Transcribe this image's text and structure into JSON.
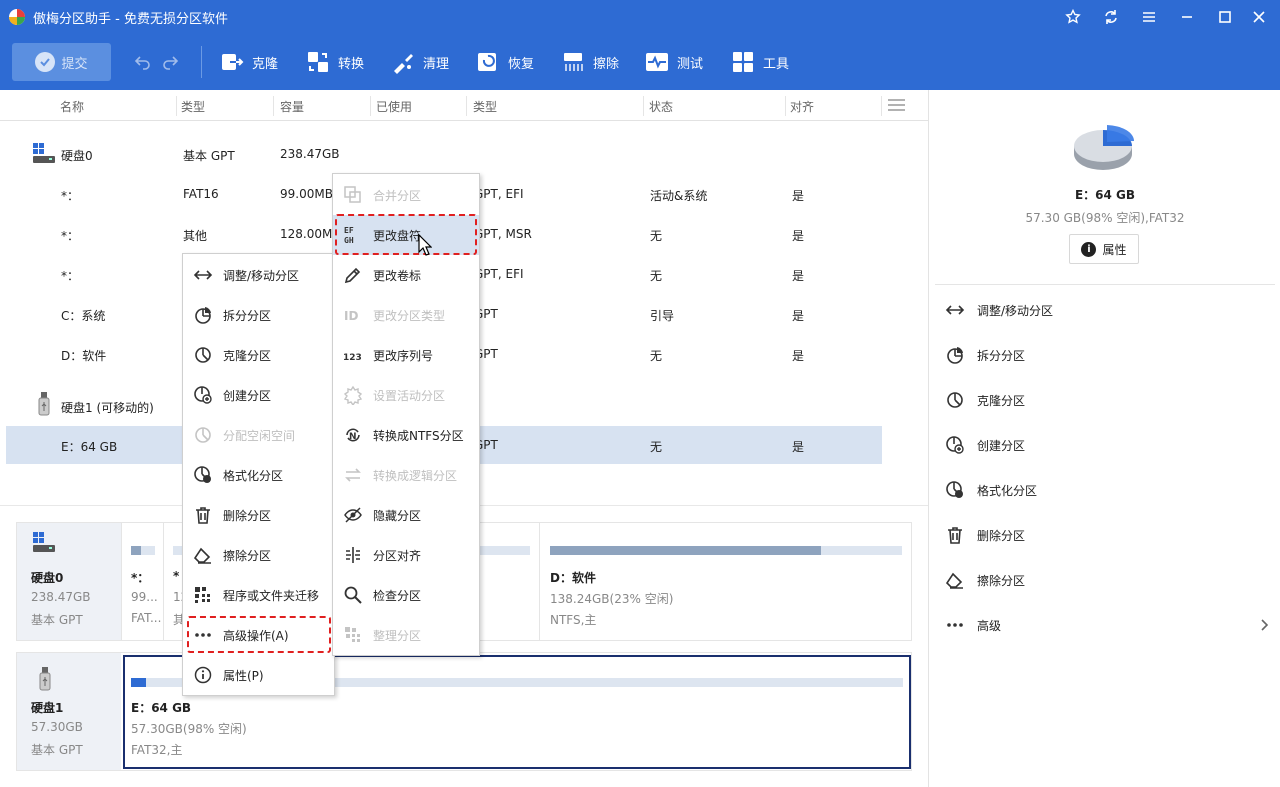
{
  "app": {
    "title": "傲梅分区助手 - 免费无损分区软件"
  },
  "toolbar": {
    "submit": "提交",
    "buttons": [
      {
        "label": "克隆",
        "icon": "clone-icon"
      },
      {
        "label": "转换",
        "icon": "convert-icon"
      },
      {
        "label": "清理",
        "icon": "clean-icon"
      },
      {
        "label": "恢复",
        "icon": "recover-icon"
      },
      {
        "label": "擦除",
        "icon": "wipe-icon"
      },
      {
        "label": "测试",
        "icon": "test-icon"
      },
      {
        "label": "工具",
        "icon": "tools-icon"
      }
    ]
  },
  "table": {
    "headers": [
      "名称",
      "类型",
      "容量",
      "已使用",
      "类型",
      "状态",
      "对齐"
    ],
    "rows": [
      {
        "name": "硬盘0",
        "type": "基本 GPT",
        "capacity": "238.47GB",
        "used": "",
        "ptype": "",
        "status": "",
        "align": ""
      },
      {
        "name": "*：",
        "type": "FAT16",
        "capacity": "99.00MB",
        "used": "",
        "ptype": "GPT, EFI",
        "status": "活动&系统",
        "align": "是"
      },
      {
        "name": "*：",
        "type": "其他",
        "capacity": "128.00MB",
        "used": "",
        "ptype": "GPT, MSR",
        "status": "无",
        "align": "是"
      },
      {
        "name": "*：",
        "type": "",
        "capacity": "",
        "used": "",
        "ptype": "GPT, EFI",
        "status": "无",
        "align": "是"
      },
      {
        "name": "C：系统",
        "type": "",
        "capacity": "",
        "used": "",
        "ptype": "GPT",
        "status": "引导",
        "align": "是"
      },
      {
        "name": "D：软件",
        "type": "",
        "capacity": "",
        "used": "",
        "ptype": "GPT",
        "status": "无",
        "align": "是"
      },
      {
        "name": "硬盘1 (可移动的)",
        "type": "",
        "capacity": "",
        "used": "",
        "ptype": "",
        "status": "",
        "align": ""
      },
      {
        "name": "E：64 GB",
        "type": "",
        "capacity": "",
        "used": "",
        "ptype": "GPT",
        "status": "无",
        "align": "是"
      }
    ]
  },
  "disk0": {
    "name": "硬盘0",
    "size": "238.47GB",
    "type": "基本 GPT",
    "parts": [
      {
        "name": "*：",
        "size": "99...",
        "fs": "FAT...",
        "fill": 0.4
      },
      {
        "name": "*",
        "size": "12",
        "fs": "其",
        "fill": 0.0
      },
      {
        "name": "D：软件",
        "size": "138.24GB(23% 空闲)",
        "fs": "NTFS,主",
        "fill": 0.77
      }
    ]
  },
  "disk1": {
    "name": "硬盘1",
    "size": "57.30GB",
    "type": "基本 GPT",
    "part": {
      "name": "E：64 GB",
      "size": "57.30GB(98% 空闲)",
      "fs": "FAT32,主",
      "fill": 0.02
    }
  },
  "side": {
    "partition_name": "E：64 GB",
    "partition_info": "57.30 GB(98% 空闲),FAT32",
    "properties": "属性",
    "ops": [
      {
        "label": "调整/移动分区",
        "icon": "resize-icon"
      },
      {
        "label": "拆分分区",
        "icon": "split-icon"
      },
      {
        "label": "克隆分区",
        "icon": "clone-partition-icon"
      },
      {
        "label": "创建分区",
        "icon": "create-partition-icon"
      },
      {
        "label": "格式化分区",
        "icon": "format-icon"
      },
      {
        "label": "删除分区",
        "icon": "delete-icon"
      },
      {
        "label": "擦除分区",
        "icon": "wipe-partition-icon"
      },
      {
        "label": "高级",
        "icon": "more-icon"
      }
    ]
  },
  "context_menu": {
    "items": [
      {
        "label": "调整/移动分区",
        "disabled": false
      },
      {
        "label": "拆分分区",
        "disabled": false
      },
      {
        "label": "克隆分区",
        "disabled": false
      },
      {
        "label": "创建分区",
        "disabled": false
      },
      {
        "label": "分配空闲空间",
        "disabled": true
      },
      {
        "label": "格式化分区",
        "disabled": false
      },
      {
        "label": "删除分区",
        "disabled": false
      },
      {
        "label": "擦除分区",
        "disabled": false
      },
      {
        "label": "程序或文件夹迁移",
        "disabled": false
      },
      {
        "label": "高级操作(A)",
        "disabled": false
      },
      {
        "label": "属性(P)",
        "disabled": false
      }
    ]
  },
  "submenu": {
    "items": [
      {
        "label": "合并分区",
        "disabled": true
      },
      {
        "label": "更改盘符",
        "disabled": false,
        "highlighted": true
      },
      {
        "label": "更改卷标",
        "disabled": false
      },
      {
        "label": "更改分区类型",
        "disabled": true
      },
      {
        "label": "更改序列号",
        "disabled": false
      },
      {
        "label": "设置活动分区",
        "disabled": true
      },
      {
        "label": "转换成NTFS分区",
        "disabled": false
      },
      {
        "label": "转换成逻辑分区",
        "disabled": true
      },
      {
        "label": "隐藏分区",
        "disabled": false
      },
      {
        "label": "分区对齐",
        "disabled": false
      },
      {
        "label": "检查分区",
        "disabled": false
      },
      {
        "label": "整理分区",
        "disabled": true
      }
    ]
  },
  "colors": {
    "titlebar": "#2e6bd3",
    "selected_row": "#d7e2f1",
    "highlight_dash": "#e02020",
    "disk_bar_fill": "#8ea3be"
  }
}
